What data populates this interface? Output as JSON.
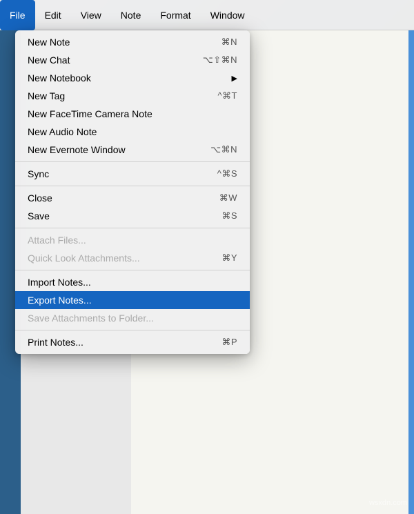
{
  "menubar": {
    "items": [
      {
        "label": "File",
        "active": true
      },
      {
        "label": "Edit",
        "active": false
      },
      {
        "label": "View",
        "active": false
      },
      {
        "label": "Note",
        "active": false
      },
      {
        "label": "Format",
        "active": false
      },
      {
        "label": "Window",
        "active": false
      }
    ]
  },
  "dropdown": {
    "items": [
      {
        "label": "New Note",
        "shortcut": "⌘N",
        "type": "normal",
        "arrow": false
      },
      {
        "label": "New Chat",
        "shortcut": "⌥⇧⌘N",
        "type": "normal",
        "arrow": false
      },
      {
        "label": "New Notebook",
        "shortcut": "",
        "type": "normal",
        "arrow": true
      },
      {
        "label": "New Tag",
        "shortcut": "^⌘T",
        "type": "normal",
        "arrow": false
      },
      {
        "label": "New FaceTime Camera Note",
        "shortcut": "",
        "type": "normal",
        "arrow": false
      },
      {
        "label": "New Audio Note",
        "shortcut": "",
        "type": "normal",
        "arrow": false
      },
      {
        "label": "New Evernote Window",
        "shortcut": "⌥⌘N",
        "type": "normal",
        "arrow": false
      },
      {
        "type": "separator"
      },
      {
        "label": "Sync",
        "shortcut": "^⌘S",
        "type": "normal",
        "arrow": false
      },
      {
        "type": "separator"
      },
      {
        "label": "Close",
        "shortcut": "⌘W",
        "type": "normal",
        "arrow": false
      },
      {
        "label": "Save",
        "shortcut": "⌘S",
        "type": "normal",
        "arrow": false
      },
      {
        "type": "separator"
      },
      {
        "label": "Attach Files...",
        "shortcut": "",
        "type": "disabled",
        "arrow": false
      },
      {
        "label": "Quick Look Attachments...",
        "shortcut": "⌘Y",
        "type": "disabled",
        "arrow": false
      },
      {
        "type": "separator"
      },
      {
        "label": "Import Notes...",
        "shortcut": "",
        "type": "normal",
        "arrow": false
      },
      {
        "label": "Export Notes...",
        "shortcut": "",
        "type": "highlighted",
        "arrow": false
      },
      {
        "label": "Save Attachments to Folder...",
        "shortcut": "",
        "type": "disabled",
        "arrow": false
      },
      {
        "type": "separator"
      },
      {
        "label": "Print Notes...",
        "shortcut": "⌘P",
        "type": "normal",
        "arrow": false
      }
    ]
  },
  "watermark": "wsxdn.com"
}
